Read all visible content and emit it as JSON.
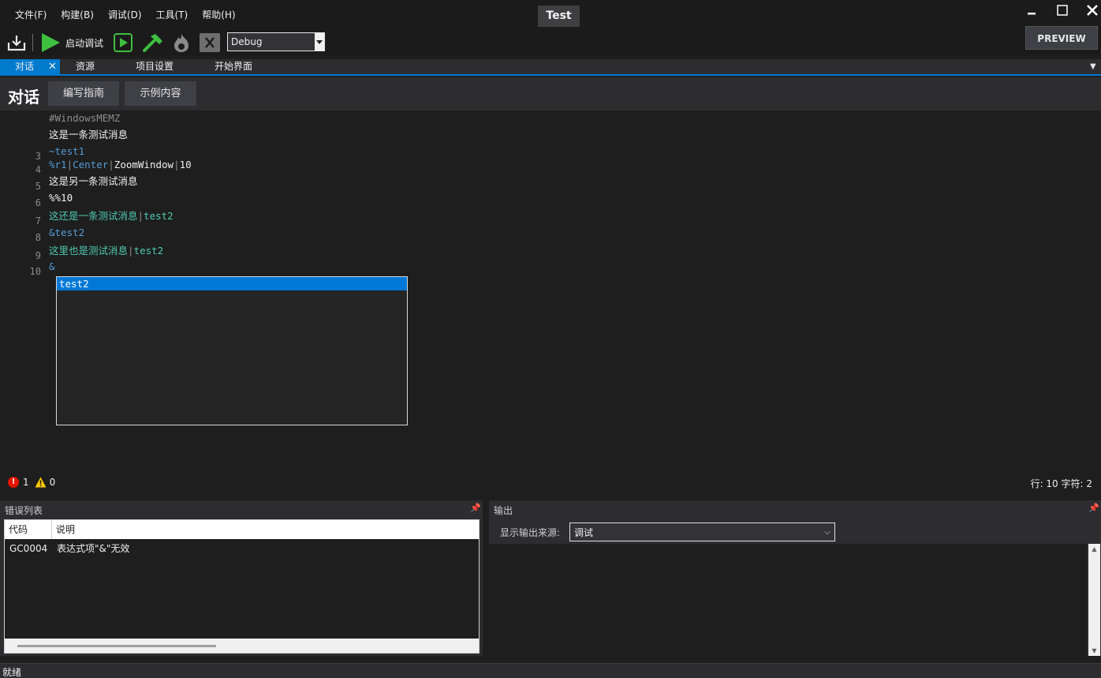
{
  "menu": [
    "文件(F)",
    "构建(B)",
    "调试(D)",
    "工具(T)",
    "帮助(H)"
  ],
  "window": {
    "title": "Test"
  },
  "toolbar": {
    "start_debug_label": "启动调试",
    "configuration": "Debug",
    "preview_label": "PREVIEW"
  },
  "tabs": [
    {
      "label": "对话",
      "active": true
    },
    {
      "label": "资源"
    },
    {
      "label": "项目设置"
    },
    {
      "label": "开始界面"
    }
  ],
  "page": {
    "title": "对话",
    "guide_button": "编写指南",
    "example_button": "示例内容"
  },
  "editor": {
    "lines": [
      {
        "no": "",
        "parts": [
          {
            "t": "#WindowsMEMZ",
            "c": "c-pipe"
          }
        ]
      },
      {
        "no": "",
        "parts": [
          {
            "t": "这是一条测试消息",
            "c": "c-white"
          }
        ]
      },
      {
        "no": "3",
        "parts": [
          {
            "t": "~test1",
            "c": "c-blue"
          }
        ]
      },
      {
        "no": "4",
        "parts": [
          {
            "t": "%r1",
            "c": "c-blue"
          },
          {
            "t": "|",
            "c": "c-pipe"
          },
          {
            "t": "Center",
            "c": "c-blue"
          },
          {
            "t": "|",
            "c": "c-pipe"
          },
          {
            "t": "ZoomWindow",
            "c": "c-white"
          },
          {
            "t": "|",
            "c": "c-pipe"
          },
          {
            "t": "10",
            "c": "c-white"
          }
        ]
      },
      {
        "no": "5",
        "parts": [
          {
            "t": "这是另一条测试消息",
            "c": "c-white"
          }
        ]
      },
      {
        "no": "6",
        "parts": [
          {
            "t": "%%10",
            "c": "c-white"
          }
        ]
      },
      {
        "no": "7",
        "parts": [
          {
            "t": "这还是一条测试消息",
            "c": "c-teal"
          },
          {
            "t": "|",
            "c": "c-pipe"
          },
          {
            "t": "test2",
            "c": "c-teal"
          }
        ]
      },
      {
        "no": "8",
        "parts": [
          {
            "t": "&test2",
            "c": "c-blue"
          }
        ]
      },
      {
        "no": "9",
        "parts": [
          {
            "t": "这里也是测试消息",
            "c": "c-teal"
          },
          {
            "t": "|",
            "c": "c-pipe"
          },
          {
            "t": "test2",
            "c": "c-teal"
          }
        ]
      },
      {
        "no": "10",
        "parts": [
          {
            "t": "&",
            "c": "c-blue"
          }
        ]
      }
    ],
    "autocomplete": [
      "test2"
    ],
    "errors_count": "1",
    "warnings_count": "0",
    "position": "行: 10   字符: 2"
  },
  "error_list": {
    "title": "错误列表",
    "columns": [
      "代码",
      "说明"
    ],
    "rows": [
      {
        "code": "GC0004",
        "desc": "表达式项\"&\"无效"
      }
    ]
  },
  "output": {
    "title": "输出",
    "source_label": "显示输出来源:",
    "source_value": "调试"
  },
  "status": {
    "text": "就绪"
  },
  "colors": {
    "accent": "#007acc",
    "error": "#e51400",
    "warning": "#ffcc00",
    "play_green": "#3fbf3f"
  }
}
